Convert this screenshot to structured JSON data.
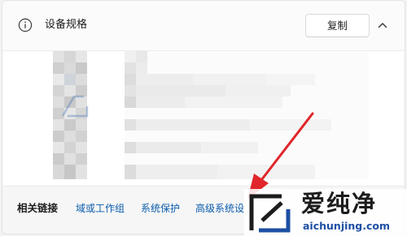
{
  "header": {
    "title": "设备规格",
    "copy_label": "复制",
    "info_icon": "info-circle-icon",
    "collapse_icon": "chevron-up-icon"
  },
  "specs": {
    "note": ""
  },
  "footer": {
    "label": "相关链接",
    "links": [
      {
        "label": "域或工作组"
      },
      {
        "label": "系统保护"
      },
      {
        "label": "高级系统设"
      }
    ]
  },
  "watermark": {
    "name": "爱纯净",
    "url": "aichunjing.com"
  },
  "colors": {
    "link": "#0b5cad",
    "arrow": "#e0262a",
    "logo_url": "#1d4fa3"
  }
}
